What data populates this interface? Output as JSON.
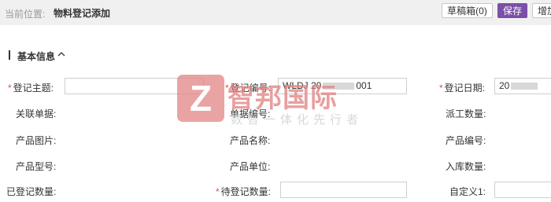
{
  "header": {
    "breadcrumb_label": "当前位置:",
    "breadcrumb_current": "物料登记添加",
    "draft_button": "草稿箱(0)",
    "save_button": "保存",
    "add_button": "增加"
  },
  "section": {
    "title": "基本信息"
  },
  "form": {
    "subject_label": "登记主题:",
    "subject_value": "",
    "reg_no_label": "登记编号:",
    "reg_no_prefix": "WLDJ 20",
    "reg_no_suffix": "001",
    "reg_date_label": "登记日期:",
    "reg_date_prefix": "20",
    "related_doc_label": "关联单据:",
    "doc_no_label": "单据编号:",
    "dispatch_qty_label": "派工数量:",
    "product_image_label": "产品图片:",
    "product_name_label": "产品名称:",
    "product_code_label": "产品编号:",
    "product_model_label": "产品型号:",
    "product_unit_label": "产品单位:",
    "stock_in_qty_label": "入库数量:",
    "registered_qty_label": "已登记数量:",
    "pending_qty_label": "待登记数量:",
    "pending_qty_value": "",
    "custom1_label": "自定义1:",
    "custom1_value": ""
  },
  "watermark": {
    "logo_letter": "Z",
    "name": "智邦国际",
    "tagline": "数智一体化先行者"
  },
  "colors": {
    "primary": "#7b4fa8",
    "required": "#d9534f",
    "topbar": "#f0f0f0",
    "watermark": "#e28484"
  }
}
